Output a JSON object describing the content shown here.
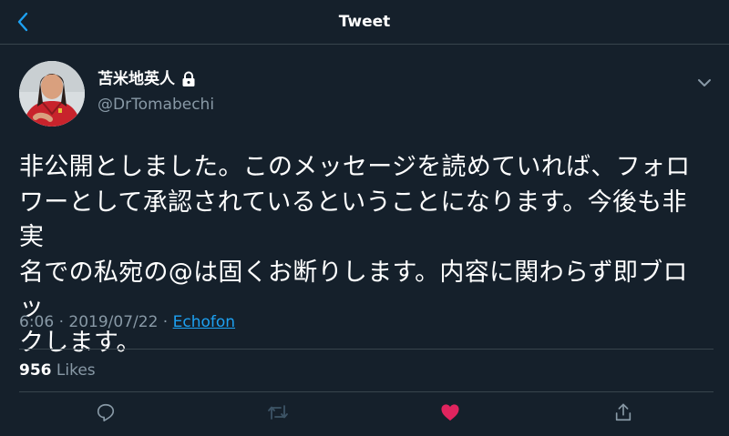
{
  "nav": {
    "title": "Tweet"
  },
  "author": {
    "name": "苫米地英人",
    "handle": "@DrTomabechi"
  },
  "tweet": {
    "lines": [
      "非公開としました。このメッセージを読めていれば、フォロ",
      "ワーとして承認されているということになります。今後も非実",
      "名での私宛の@は固くお断りします。内容に関わらず即ブロッ",
      "クします。"
    ]
  },
  "meta": {
    "time": "6:06",
    "sep1": " · ",
    "date": "2019/07/22",
    "sep2": " · ",
    "client": "Echofon"
  },
  "stats": {
    "likes_count": "956",
    "likes_label": "Likes"
  },
  "colors": {
    "background": "#15202b",
    "accent": "#1da1f2",
    "like": "#e0245e",
    "muted": "#8899a6",
    "divider": "#38444d"
  },
  "icons": [
    "back-icon",
    "lock-icon",
    "chevron-down-icon",
    "reply-icon",
    "retweet-icon",
    "like-icon",
    "share-icon"
  ]
}
